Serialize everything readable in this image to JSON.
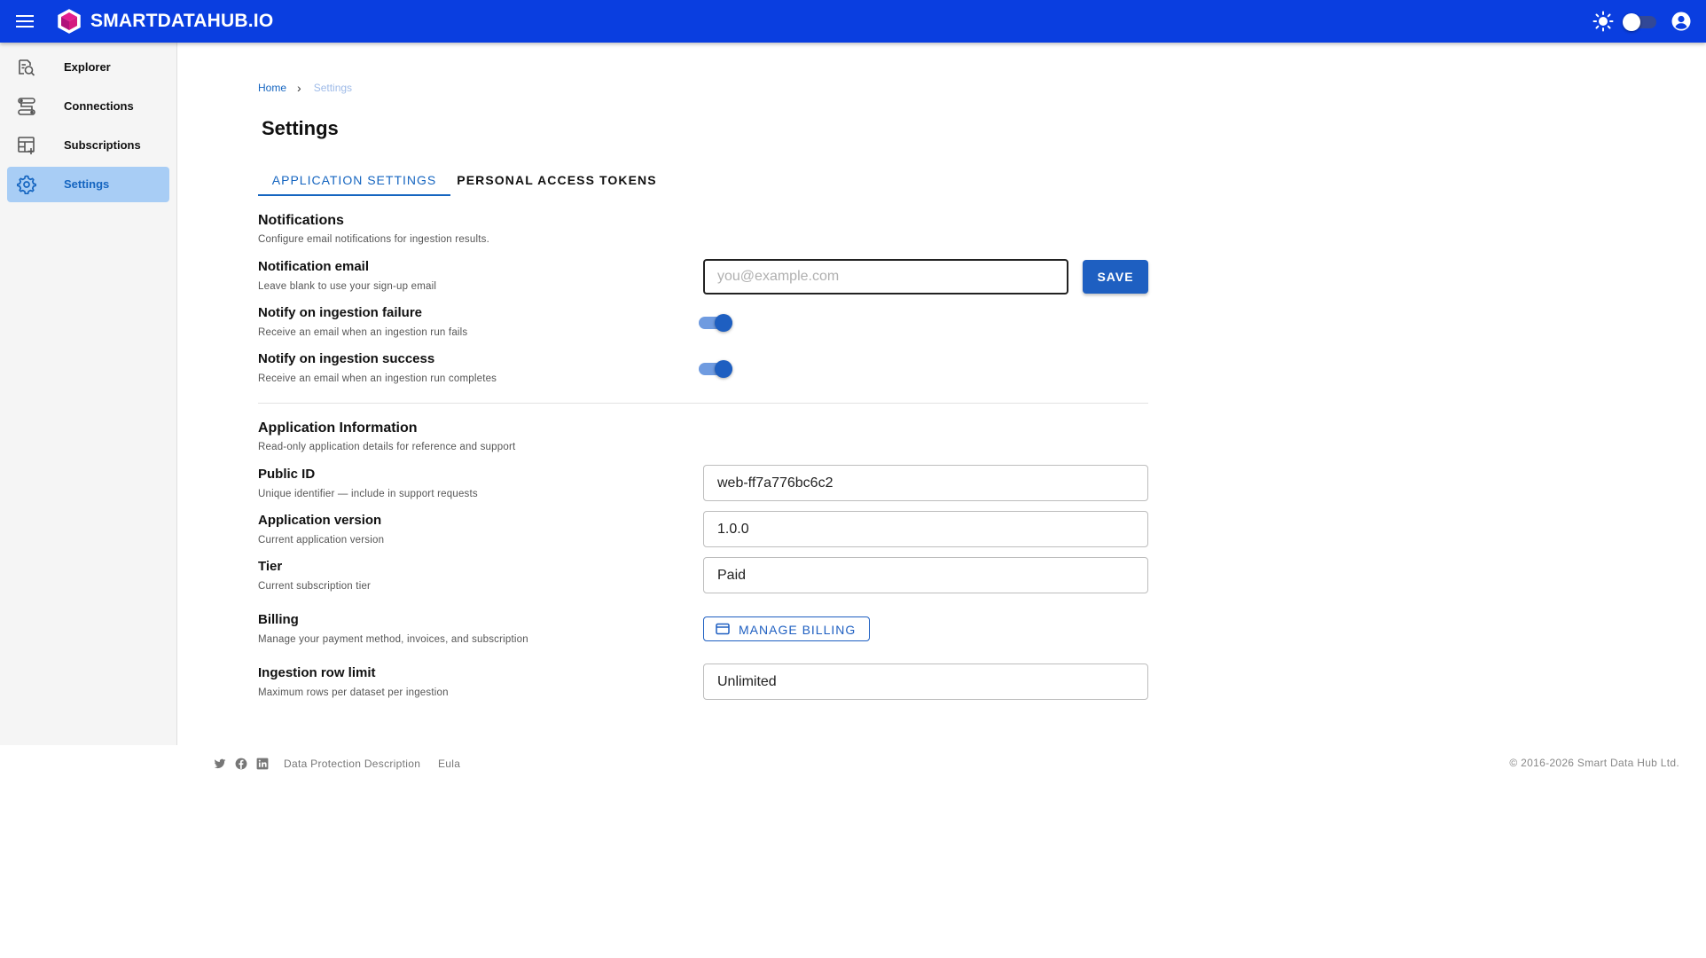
{
  "app": {
    "brand": "SMARTDATAHUB.IO"
  },
  "colors": {
    "primary": "#0a3ee0",
    "accent": "#1565c0",
    "active_nav_bg": "#a8cdf5"
  },
  "topbar": {
    "icons": [
      "menu-icon",
      "cube-logo-icon",
      "sun-icon",
      "theme-toggle",
      "account-circle-icon"
    ]
  },
  "sidebar": {
    "items": [
      {
        "label": "Explorer",
        "icon": "search-document-icon",
        "active": false
      },
      {
        "label": "Connections",
        "icon": "connections-icon",
        "active": false
      },
      {
        "label": "Subscriptions",
        "icon": "table-icon",
        "active": false
      },
      {
        "label": "Settings",
        "icon": "gear-icon",
        "active": true
      }
    ]
  },
  "breadcrumb": {
    "home": "Home",
    "separator": "›",
    "current": "Settings"
  },
  "page": {
    "title": "Settings"
  },
  "tabs": [
    {
      "label": "APPLICATION SETTINGS",
      "active": true
    },
    {
      "label": "PERSONAL ACCESS TOKENS",
      "active": false
    }
  ],
  "notifications": {
    "title": "Notifications",
    "desc": "Configure email notifications for ingestion results.",
    "email": {
      "title": "Notification email",
      "desc": "Leave blank to use your sign-up email",
      "placeholder": "you@example.com",
      "value": "",
      "save_label": "SAVE"
    },
    "failure": {
      "title": "Notify on ingestion failure",
      "desc": "Receive an email when an ingestion run fails",
      "enabled": true
    },
    "success": {
      "title": "Notify on ingestion success",
      "desc": "Receive an email when an ingestion run completes",
      "enabled": true
    }
  },
  "app_info": {
    "title": "Application Information",
    "desc": "Read-only application details for reference and support",
    "public_id": {
      "title": "Public ID",
      "desc": "Unique identifier — include in support requests",
      "value": "web-ff7a776bc6c2"
    },
    "version": {
      "title": "Application version",
      "desc": "Current application version",
      "value": "1.0.0"
    },
    "tier": {
      "title": "Tier",
      "desc": "Current subscription tier",
      "value": "Paid"
    },
    "billing": {
      "title": "Billing",
      "desc": "Manage your payment method, invoices, and subscription",
      "button_label": "MANAGE BILLING"
    },
    "row_limit": {
      "title": "Ingestion row limit",
      "desc": "Maximum rows per dataset per ingestion",
      "value": "Unlimited"
    }
  },
  "footer": {
    "links": [
      "Data Protection Description",
      "Eula"
    ],
    "social": [
      "twitter-icon",
      "facebook-icon",
      "linkedin-icon"
    ],
    "copyright": "© 2016-2026 Smart Data Hub Ltd."
  }
}
